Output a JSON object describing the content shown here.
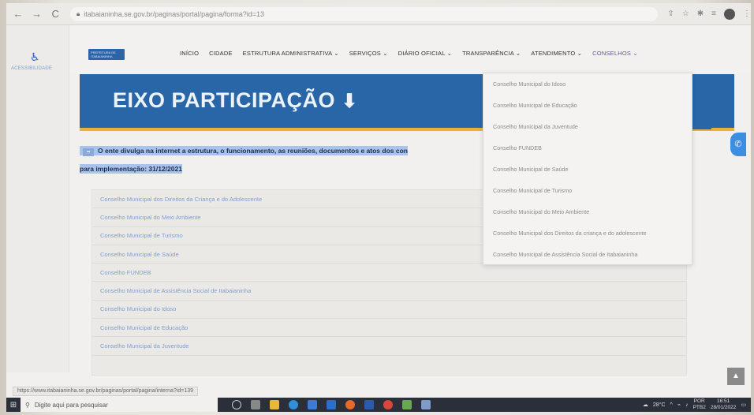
{
  "browser": {
    "url": "itabaianinha.se.gov.br/paginas/portal/pagina/forma?id=13",
    "back_icon": "←",
    "forward_icon": "→",
    "reload_icon": "C"
  },
  "accessibility": {
    "label": "ACESSIBILIDADE"
  },
  "logo_text": "PREFEITURA DE ITABAIANINHA",
  "nav": {
    "items": [
      "INÍCIO",
      "CIDADE",
      "ESTRUTURA ADMINISTRATIVA ⌄",
      "SERVIÇOS ⌄",
      "DIÁRIO OFICIAL ⌄",
      "TRANSPARÊNCIA ⌄",
      "ATENDIMENTO ⌄",
      "CONSELHOS ⌄"
    ]
  },
  "banner": {
    "title": "EIXO PARTICIPAÇÃO",
    "arrow": "⬇"
  },
  "paragraph": {
    "line1": "O ente divulga na internet a estrutura, o funcionamento, as reuniões, documentos e atos dos con",
    "line2": "para implementação: 31/12/2021"
  },
  "list": {
    "items": [
      "Conselho Municipal dos Direitos da Criança e do Adolescente",
      "Conselho Municipal do Meio Ambiente",
      "Conselho Municipal de Turismo",
      "Conselho Municipal de Saúde",
      "Conselho FUNDEB",
      "Conselho Municipal de Assistência Social de Itabaianinha",
      "Conselho Municipal do Idoso",
      "Conselho Municipal de Educação",
      "Conselho Municipal da Juventude"
    ]
  },
  "dropdown": {
    "items": [
      "Conselho Municipal do Idoso",
      "Conselho Municipal de Educação",
      "Conselho Municipal da Juventude",
      "Conselho FUNDEB",
      "Conselho Municipal de Saúde",
      "Conselho Municipal de Turismo",
      "Conselho Municipal do Meio Ambiente",
      "Conselho Municipal dos Direitos da criança e do adolescente",
      "Conselho Municipal de Assistência Social de Itabaianinha"
    ]
  },
  "status_url": "https://www.itabaianinha.se.gov.br/paginas/portal/pagina/interna?id=139",
  "taskbar": {
    "search_placeholder": "Digite aqui para pesquisar",
    "temperature": "28°C",
    "lang1": "POR",
    "lang2": "PTB2",
    "time": "16:51",
    "date": "28/01/2022"
  },
  "colors": {
    "banner_blue": "#2966a8",
    "banner_accent": "#e9b33b",
    "highlight": "#a9c4ec",
    "link_blue": "#7f9fcf"
  }
}
